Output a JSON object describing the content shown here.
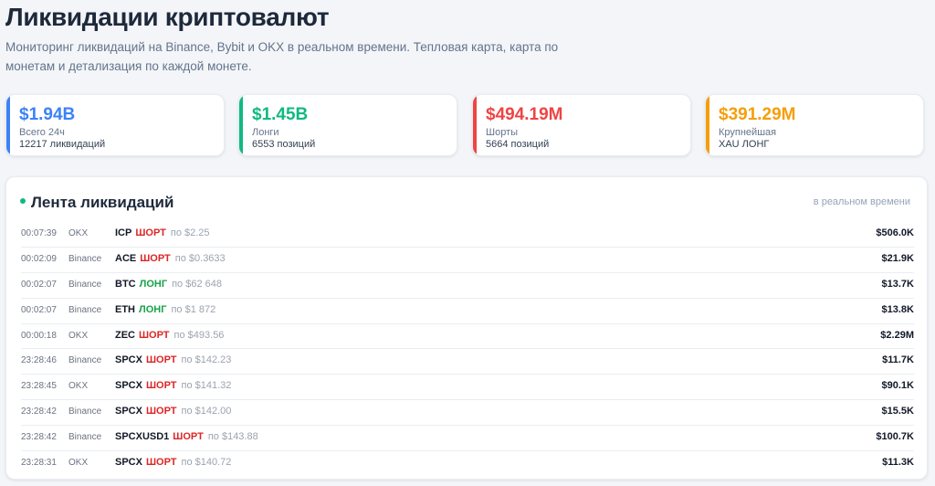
{
  "header": {
    "title": "Ликвидации криптовалют",
    "subtitle": "Мониторинг ликвидаций на Binance, Bybit и OKX в реальном времени. Тепловая карта, карта по монетам и детализация по каждой монете."
  },
  "stats": [
    {
      "value": "$1.94B",
      "label": "Всего 24ч",
      "sub": "12217 ликвидаций",
      "color": "#3b82f6"
    },
    {
      "value": "$1.45B",
      "label": "Лонги",
      "sub": "6553 позиций",
      "color": "#10b981"
    },
    {
      "value": "$494.19M",
      "label": "Шорты",
      "sub": "5664 позиций",
      "color": "#ef4444"
    },
    {
      "value": "$391.29M",
      "label": "Крупнейшая",
      "sub": "XAU ЛОНГ",
      "color": "#f59e0b"
    }
  ],
  "feed": {
    "title": "Лента ликвидаций",
    "live_label": "в реальном времени",
    "rows": [
      {
        "time": "00:07:39",
        "exchange": "OKX",
        "symbol": "ICP",
        "side": "ШОРТ",
        "side_type": "short",
        "price": "по $2.25",
        "value": "$506.0K"
      },
      {
        "time": "00:02:09",
        "exchange": "Binance",
        "symbol": "ACE",
        "side": "ШОРТ",
        "side_type": "short",
        "price": "по $0.3633",
        "value": "$21.9K"
      },
      {
        "time": "00:02:07",
        "exchange": "Binance",
        "symbol": "BTC",
        "side": "ЛОНГ",
        "side_type": "long",
        "price": "по $62 648",
        "value": "$13.7K"
      },
      {
        "time": "00:02:07",
        "exchange": "Binance",
        "symbol": "ETH",
        "side": "ЛОНГ",
        "side_type": "long",
        "price": "по $1 872",
        "value": "$13.8K"
      },
      {
        "time": "00:00:18",
        "exchange": "OKX",
        "symbol": "ZEC",
        "side": "ШОРТ",
        "side_type": "short",
        "price": "по $493.56",
        "value": "$2.29M"
      },
      {
        "time": "23:28:46",
        "exchange": "Binance",
        "symbol": "SPCX",
        "side": "ШОРТ",
        "side_type": "short",
        "price": "по $142.23",
        "value": "$11.7K"
      },
      {
        "time": "23:28:45",
        "exchange": "OKX",
        "symbol": "SPCX",
        "side": "ШОРТ",
        "side_type": "short",
        "price": "по $141.32",
        "value": "$90.1K"
      },
      {
        "time": "23:28:42",
        "exchange": "Binance",
        "symbol": "SPCX",
        "side": "ШОРТ",
        "side_type": "short",
        "price": "по $142.00",
        "value": "$15.5K"
      },
      {
        "time": "23:28:42",
        "exchange": "Binance",
        "symbol": "SPCXUSD1",
        "side": "ШОРТ",
        "side_type": "short",
        "price": "по $143.88",
        "value": "$100.7K"
      },
      {
        "time": "23:28:31",
        "exchange": "OKX",
        "symbol": "SPCX",
        "side": "ШОРТ",
        "side_type": "short",
        "price": "по $140.72",
        "value": "$11.3K"
      }
    ]
  }
}
